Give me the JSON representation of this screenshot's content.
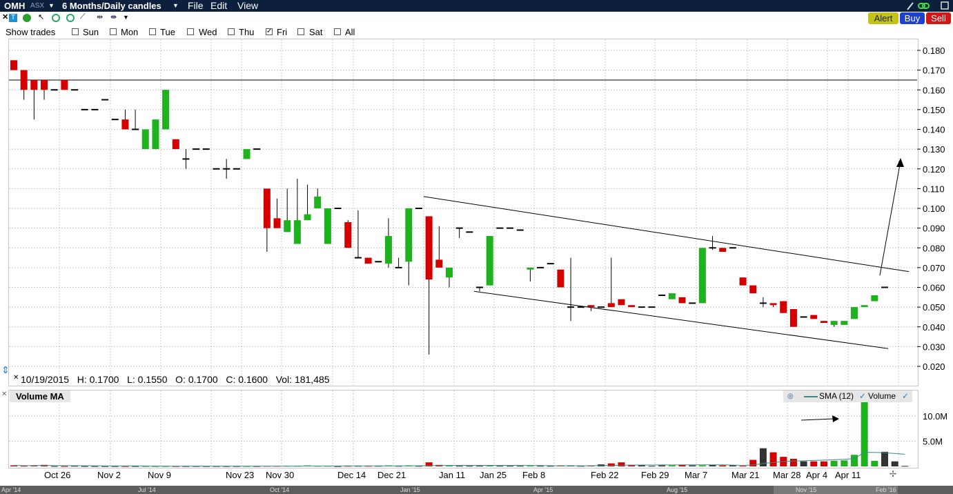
{
  "header": {
    "symbol": "OMH",
    "exchange": "ASX",
    "period": "6 Months/Daily candles",
    "menu": [
      "File",
      "Edit",
      "View"
    ]
  },
  "toolbar": {
    "alert_label": "Alert",
    "buy_label": "Buy",
    "sell_label": "Sell"
  },
  "show_trades": {
    "label": "Show trades",
    "days": [
      {
        "label": "Sun",
        "checked": false
      },
      {
        "label": "Mon",
        "checked": false
      },
      {
        "label": "Tue",
        "checked": false
      },
      {
        "label": "Wed",
        "checked": false
      },
      {
        "label": "Thu",
        "checked": false
      },
      {
        "label": "Fri",
        "checked": true
      },
      {
        "label": "Sat",
        "checked": false
      },
      {
        "label": "All",
        "checked": false
      }
    ]
  },
  "info_line": "10/19/2015   H: 0.1700   L: 0.1550   O: 0.1700   C: 0.1600   Vol: 181,485",
  "volume_panel": {
    "title": "Volume MA",
    "legend": [
      "SMA (12)",
      "Volume"
    ],
    "ticks": [
      "10.0M",
      "5.0M"
    ]
  },
  "colors": {
    "up": "#1fb21f",
    "down": "#d40000",
    "titlebar": "#0c1f3d",
    "alert": "#c2c21a",
    "buy": "#1f3fcf",
    "sell": "#d01818"
  },
  "x_labels": [
    "Oct 26",
    "Nov 2",
    "Nov 9",
    "Nov 23",
    "Nov 30",
    "Dec 14",
    "Dec 21",
    "Jan 11",
    "Jan 25",
    "Feb 8",
    "Feb 22",
    "Feb 29",
    "Mar 7",
    "Mar 21",
    "Mar 28",
    "Apr 4",
    "Apr 11"
  ],
  "bottom_labels": [
    "Apr '14",
    "Jul '14",
    "Oct '14",
    "Jan '15",
    "Apr '15",
    "Aug '15",
    "Nov '15",
    "Feb '16"
  ],
  "chart_data": {
    "type": "candlestick",
    "ylim": [
      0.015,
      0.185
    ],
    "y_ticks": [
      "0.180",
      "0.170",
      "0.160",
      "0.150",
      "0.140",
      "0.130",
      "0.120",
      "0.110",
      "0.100",
      "0.090",
      "0.080",
      "0.070",
      "0.060",
      "0.050",
      "0.040",
      "0.030",
      "0.020"
    ],
    "horizontal_line": 0.165,
    "candles": [
      [
        0.175,
        0.17,
        0.175,
        0.17
      ],
      [
        0.17,
        0.16,
        0.17,
        0.155
      ],
      [
        0.165,
        0.16,
        0.165,
        0.145
      ],
      [
        0.165,
        0.16,
        0.165,
        0.155
      ],
      [
        0.16,
        0.16,
        0.16,
        0.16
      ],
      [
        0.165,
        0.16,
        0.165,
        0.16
      ],
      [
        0.16,
        0.16,
        0.16,
        0.16
      ],
      [
        0.15,
        0.15,
        0.15,
        0.15
      ],
      [
        0.15,
        0.15,
        0.15,
        0.15
      ],
      [
        0.155,
        0.155,
        0.155,
        0.155
      ],
      [
        0.145,
        0.145,
        0.145,
        0.145
      ],
      [
        0.145,
        0.14,
        0.15,
        0.14
      ],
      [
        0.14,
        0.14,
        0.15,
        0.14
      ],
      [
        0.13,
        0.14,
        0.14,
        0.13
      ],
      [
        0.13,
        0.145,
        0.145,
        0.13
      ],
      [
        0.14,
        0.16,
        0.16,
        0.14
      ],
      [
        0.135,
        0.13,
        0.135,
        0.13
      ],
      [
        0.125,
        0.125,
        0.13,
        0.12
      ],
      [
        0.13,
        0.13,
        0.13,
        0.13
      ],
      [
        0.13,
        0.13,
        0.13,
        0.13
      ],
      [
        0.12,
        0.12,
        0.12,
        0.12
      ],
      [
        0.12,
        0.12,
        0.125,
        0.115
      ],
      [
        0.12,
        0.12,
        0.12,
        0.12
      ],
      [
        0.125,
        0.13,
        0.13,
        0.125
      ],
      [
        0.13,
        0.13,
        0.13,
        0.13
      ],
      [
        0.11,
        0.09,
        0.11,
        0.078
      ],
      [
        0.095,
        0.09,
        0.105,
        0.09
      ],
      [
        0.088,
        0.094,
        0.11,
        0.088
      ],
      [
        0.082,
        0.094,
        0.115,
        0.082
      ],
      [
        0.094,
        0.097,
        0.112,
        0.094
      ],
      [
        0.1,
        0.106,
        0.11,
        0.1
      ],
      [
        0.082,
        0.1,
        0.1,
        0.082
      ],
      [
        0.1,
        0.1,
        0.1,
        0.1
      ],
      [
        0.093,
        0.08,
        0.094,
        0.08
      ],
      [
        0.075,
        0.075,
        0.099,
        0.075
      ],
      [
        0.075,
        0.072,
        0.075,
        0.072
      ],
      [
        0.073,
        0.073,
        0.073,
        0.073
      ],
      [
        0.072,
        0.086,
        0.095,
        0.07
      ],
      [
        0.07,
        0.07,
        0.075,
        0.07
      ],
      [
        0.073,
        0.1,
        0.1,
        0.061
      ],
      [
        0.1,
        0.1,
        0.1,
        0.1
      ],
      [
        0.096,
        0.064,
        0.096,
        0.026
      ],
      [
        0.074,
        0.07,
        0.091,
        0.07
      ],
      [
        0.065,
        0.07,
        0.07,
        0.06
      ],
      [
        0.09,
        0.09,
        0.09,
        0.085
      ],
      [
        0.088,
        0.088,
        0.088,
        0.088
      ],
      [
        0.06,
        0.06,
        0.06,
        0.058
      ],
      [
        0.061,
        0.086,
        0.086,
        0.061
      ],
      [
        0.09,
        0.09,
        0.09,
        0.09
      ],
      [
        0.09,
        0.09,
        0.09,
        0.09
      ],
      [
        0.089,
        0.089,
        0.089,
        0.089
      ],
      [
        0.069,
        0.07,
        0.07,
        0.063
      ],
      [
        0.07,
        0.07,
        0.07,
        0.07
      ],
      [
        0.072,
        0.072,
        0.072,
        0.072
      ],
      [
        0.069,
        0.06,
        0.069,
        0.06
      ],
      [
        0.05,
        0.05,
        0.075,
        0.043
      ],
      [
        0.05,
        0.05,
        0.05,
        0.05
      ],
      [
        0.051,
        0.05,
        0.051,
        0.048
      ],
      [
        0.05,
        0.05,
        0.05,
        0.05
      ],
      [
        0.052,
        0.05,
        0.075,
        0.05
      ],
      [
        0.054,
        0.051,
        0.054,
        0.051
      ],
      [
        0.051,
        0.05,
        0.051,
        0.05
      ],
      [
        0.05,
        0.05,
        0.05,
        0.05
      ],
      [
        0.05,
        0.05,
        0.05,
        0.05
      ],
      [
        0.056,
        0.056,
        0.056,
        0.056
      ],
      [
        0.054,
        0.057,
        0.057,
        0.054
      ],
      [
        0.055,
        0.052,
        0.055,
        0.052
      ],
      [
        0.052,
        0.052,
        0.052,
        0.052
      ],
      [
        0.052,
        0.08,
        0.08,
        0.052
      ],
      [
        0.08,
        0.08,
        0.086,
        0.079
      ],
      [
        0.08,
        0.078,
        0.08,
        0.078
      ],
      [
        0.08,
        0.08,
        0.08,
        0.08
      ],
      [
        0.065,
        0.061,
        0.065,
        0.061
      ],
      [
        0.061,
        0.057,
        0.061,
        0.057
      ],
      [
        0.052,
        0.052,
        0.055,
        0.05
      ],
      [
        0.052,
        0.051,
        0.052,
        0.05
      ],
      [
        0.053,
        0.047,
        0.053,
        0.047
      ],
      [
        0.049,
        0.04,
        0.049,
        0.04
      ],
      [
        0.045,
        0.045,
        0.045,
        0.045
      ],
      [
        0.046,
        0.044,
        0.046,
        0.044
      ],
      [
        0.043,
        0.042,
        0.043,
        0.042
      ],
      [
        0.041,
        0.043,
        0.043,
        0.04
      ],
      [
        0.041,
        0.043,
        0.043,
        0.041
      ],
      [
        0.044,
        0.05,
        0.05,
        0.044
      ],
      [
        0.05,
        0.051,
        0.051,
        0.05
      ],
      [
        0.053,
        0.056,
        0.056,
        0.053
      ],
      [
        0.06,
        0.06,
        0.06,
        0.06
      ]
    ],
    "volumes_m": [
      0.2,
      0.1,
      0.2,
      0.3,
      0.05,
      0.05,
      0.1,
      0.05,
      0.05,
      0.05,
      0.05,
      0.05,
      0.05,
      0.05,
      0.05,
      0.05,
      0.05,
      0.05,
      0.05,
      0.05,
      0.05,
      0.05,
      0.05,
      0.05,
      0.05,
      0.1,
      0.1,
      0.1,
      0.1,
      0.2,
      0.1,
      0.1,
      0.05,
      0.1,
      0.1,
      0.1,
      0.1,
      0.2,
      0.1,
      0.2,
      0.1,
      0.8,
      0.3,
      0.2,
      0.1,
      0.1,
      0.1,
      0.2,
      0.1,
      0.1,
      0.1,
      0.1,
      0.1,
      0.1,
      0.2,
      0.2,
      0.1,
      0.2,
      0.4,
      0.6,
      0.8,
      0.3,
      0.2,
      0.1,
      0.2,
      0.2,
      0.3,
      0.2,
      0.2,
      0.3,
      0.2,
      0.2,
      0.1,
      1.3,
      3.6,
      2.8,
      1.9,
      1.5,
      1.0,
      1.0,
      1.0,
      1.1,
      1.2,
      2.3,
      14.8,
      1.1,
      2.9,
      1.0,
      0.1
    ],
    "sma_line": true
  }
}
